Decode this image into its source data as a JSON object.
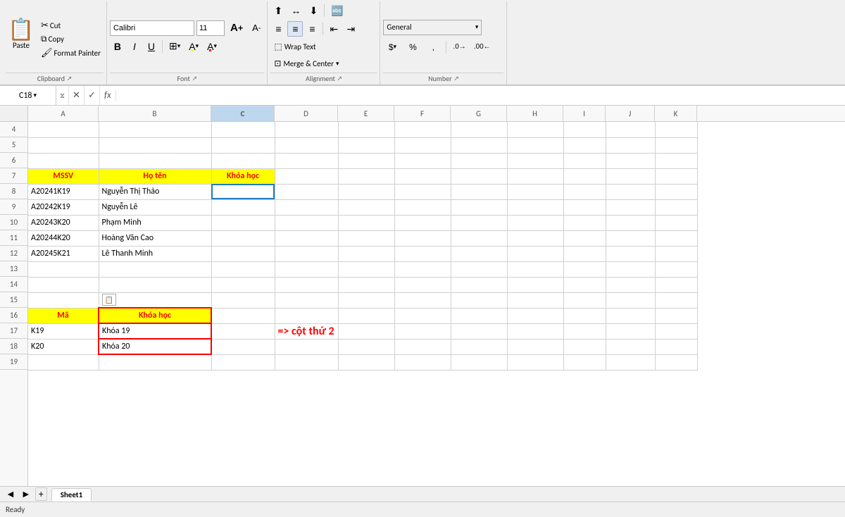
{
  "ribbon": {
    "clipboard": {
      "label": "Clipboard",
      "paste_label": "Paste",
      "cut_label": "Cut",
      "copy_label": "Copy",
      "format_painter_label": "Format Painter"
    },
    "font": {
      "label": "Font",
      "name": "Calibri",
      "size": "11",
      "grow_icon": "A",
      "shrink_icon": "A",
      "bold": "B",
      "italic": "I",
      "underline": "U",
      "borders_icon": "▦",
      "fill_icon": "A",
      "font_color_icon": "A"
    },
    "alignment": {
      "label": "Alignment",
      "wrap_text": "Wrap Text",
      "merge_center": "Merge & Center"
    },
    "number": {
      "label": "Number",
      "format": "General",
      "dollar": "$",
      "percent": "%",
      "comma": ",",
      "dec_increase": ".0",
      "dec_decrease": ".00"
    }
  },
  "formula_bar": {
    "cell_ref": "C18",
    "fx": "fx"
  },
  "columns": [
    "A",
    "B",
    "C",
    "D",
    "E",
    "F",
    "G",
    "H",
    "I",
    "J",
    "K"
  ],
  "rows": [
    {
      "num": 4,
      "a": "",
      "b": "",
      "c": "",
      "d": "",
      "e": "",
      "f": "",
      "g": "",
      "h": "",
      "i": "",
      "j": "",
      "k": ""
    },
    {
      "num": 5,
      "a": "",
      "b": "",
      "c": "",
      "d": "",
      "e": "",
      "f": "",
      "g": "",
      "h": "",
      "i": "",
      "j": "",
      "k": ""
    },
    {
      "num": 6,
      "a": "",
      "b": "",
      "c": "",
      "d": "",
      "e": "",
      "f": "",
      "g": "",
      "h": "",
      "i": "",
      "j": "",
      "k": ""
    },
    {
      "num": 7,
      "a": "MSSV",
      "b": "Họ tên",
      "c": "Khóa học",
      "d": "",
      "e": "",
      "f": "",
      "g": "",
      "h": "",
      "i": "",
      "j": "",
      "k": "",
      "row7": true
    },
    {
      "num": 8,
      "a": "A20241K19",
      "b": "Nguyễn Thị Thảo",
      "c": "",
      "d": "",
      "e": "",
      "f": "",
      "g": "",
      "h": "",
      "i": "",
      "j": "",
      "k": ""
    },
    {
      "num": 9,
      "a": "A20242K19",
      "b": "Nguyễn Lê",
      "c": "",
      "d": "",
      "e": "",
      "f": "",
      "g": "",
      "h": "",
      "i": "",
      "j": "",
      "k": ""
    },
    {
      "num": 10,
      "a": "A20243K20",
      "b": "Phạm Minh",
      "c": "",
      "d": "",
      "e": "",
      "f": "",
      "g": "",
      "h": "",
      "i": "",
      "j": "",
      "k": ""
    },
    {
      "num": 11,
      "a": "A20244K20",
      "b": "Hoàng Văn Cao",
      "c": "",
      "d": "",
      "e": "",
      "f": "",
      "g": "",
      "h": "",
      "i": "",
      "j": "",
      "k": ""
    },
    {
      "num": 12,
      "a": "A20245K21",
      "b": "Lê Thanh Minh",
      "c": "",
      "d": "",
      "e": "",
      "f": "",
      "g": "",
      "h": "",
      "i": "",
      "j": "",
      "k": ""
    },
    {
      "num": 13,
      "a": "",
      "b": "",
      "c": "",
      "d": "",
      "e": "",
      "f": "",
      "g": "",
      "h": "",
      "i": "",
      "j": "",
      "k": ""
    },
    {
      "num": 14,
      "a": "",
      "b": "",
      "c": "",
      "d": "",
      "e": "",
      "f": "",
      "g": "",
      "h": "",
      "i": "",
      "j": "",
      "k": ""
    },
    {
      "num": 15,
      "a": "",
      "b": "",
      "c": "",
      "d": "",
      "e": "",
      "f": "",
      "g": "",
      "h": "",
      "i": "",
      "j": "",
      "k": "",
      "has_icon": true
    },
    {
      "num": 16,
      "a": "Mã",
      "b": "Khóa học",
      "c": "",
      "d": "",
      "e": "",
      "f": "",
      "g": "",
      "h": "",
      "i": "",
      "j": "",
      "k": "",
      "row16": true
    },
    {
      "num": 17,
      "a": "K19",
      "b": "Khóa 19",
      "c": "",
      "d": "",
      "e": "",
      "f": "",
      "g": "",
      "h": "",
      "i": "",
      "j": "",
      "k": "",
      "lookup_text": "=> cột thứ 2"
    },
    {
      "num": 18,
      "a": "K20",
      "b": "Khóa 20",
      "c": "",
      "d": "",
      "e": "",
      "f": "",
      "g": "",
      "h": "",
      "i": "",
      "j": "",
      "k": ""
    },
    {
      "num": 19,
      "a": "",
      "b": "",
      "c": "",
      "d": "",
      "e": "",
      "f": "",
      "g": "",
      "h": "",
      "i": "",
      "j": "",
      "k": ""
    }
  ],
  "sheet_tabs": [
    "Sheet1"
  ],
  "status": "Ready"
}
